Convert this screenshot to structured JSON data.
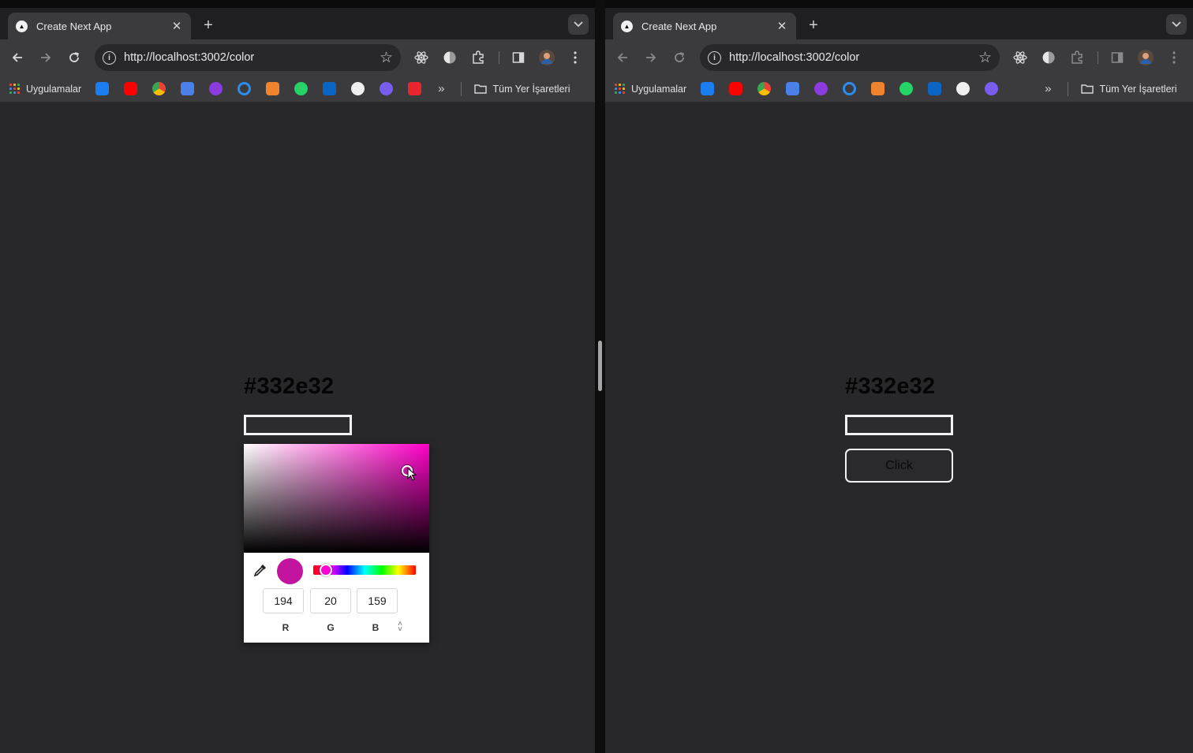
{
  "browser": {
    "tab_title": "Create Next App",
    "url": "http://localhost:3002/color",
    "bookmarks_apps_label": "Uygulamalar",
    "bookmarks_all_label": "Tüm Yer İşaretleri",
    "more_bookmarks": "»",
    "bookmark_icons": [
      "safari-icon",
      "youtube-icon",
      "chrome-icon",
      "translate-icon",
      "purple-app-icon",
      "refresh-blue-icon",
      "orange-app-icon",
      "whatsapp-icon",
      "linkedin-icon",
      "github-icon",
      "gmail-icon",
      "red-app-icon"
    ]
  },
  "left": {
    "hex_heading": "#332e32",
    "picker": {
      "r": "194",
      "g": "20",
      "b": "159",
      "r_label": "R",
      "g_label": "G",
      "b_label": "B",
      "swatch_color": "#c2149f"
    }
  },
  "right": {
    "hex_heading": "#332e32",
    "button_label": "Click"
  }
}
